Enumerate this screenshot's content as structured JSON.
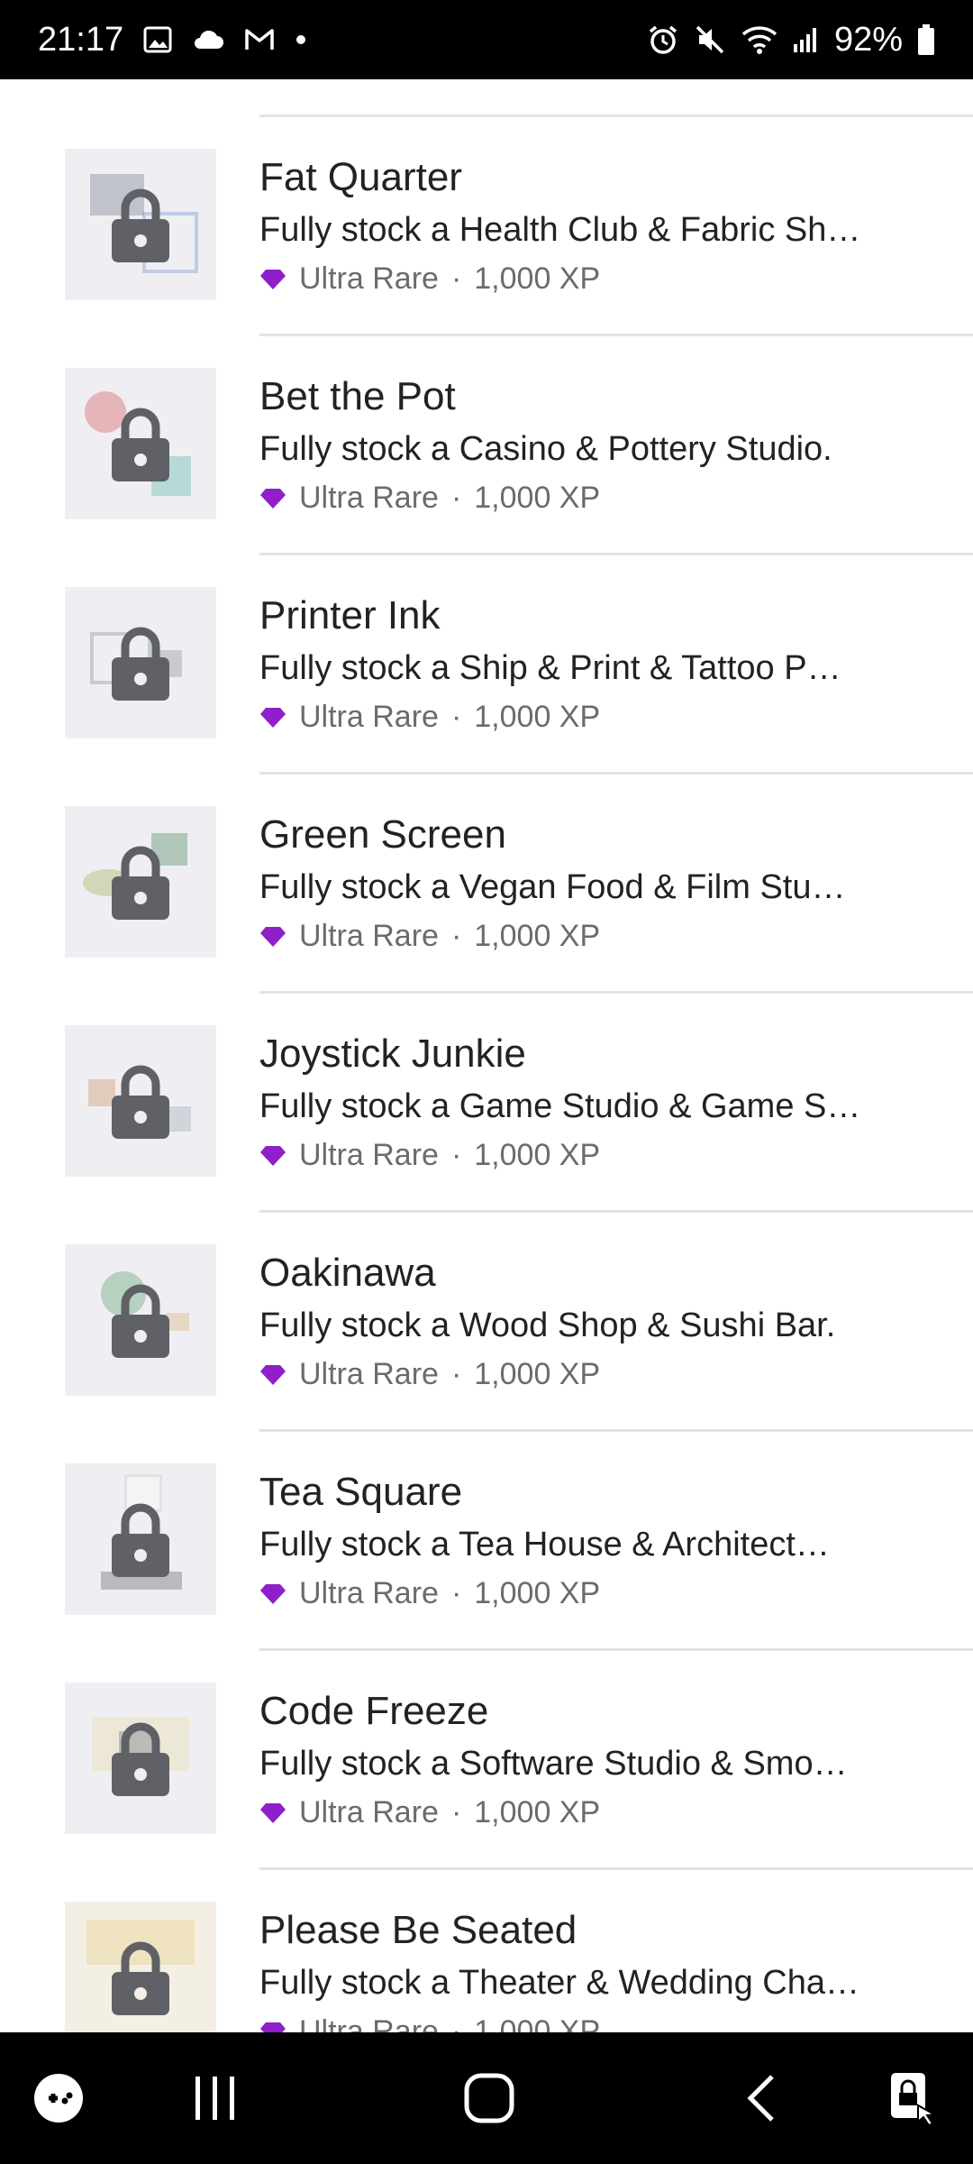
{
  "status_bar": {
    "time": "21:17",
    "battery_percent": "92%",
    "left_icons": [
      "gallery-icon",
      "cloud-icon",
      "gmail-icon",
      "dot-icon"
    ],
    "right_icons": [
      "alarm-icon",
      "mute-icon",
      "wifi-icon",
      "signal-icon",
      "battery-icon"
    ]
  },
  "achievements": [
    {
      "title": "Fat Quarter",
      "description": "Fully stock a Health Club & Fabric Sh…",
      "rarity": "Ultra Rare",
      "xp": "1,000 XP"
    },
    {
      "title": "Bet the Pot",
      "description": "Fully stock a Casino & Pottery Studio.",
      "rarity": "Ultra Rare",
      "xp": "1,000 XP"
    },
    {
      "title": "Printer Ink",
      "description": "Fully stock a Ship & Print & Tattoo P…",
      "rarity": "Ultra Rare",
      "xp": "1,000 XP"
    },
    {
      "title": "Green Screen",
      "description": "Fully stock a Vegan Food & Film Stu…",
      "rarity": "Ultra Rare",
      "xp": "1,000 XP"
    },
    {
      "title": "Joystick Junkie",
      "description": "Fully stock a Game Studio & Game S…",
      "rarity": "Ultra Rare",
      "xp": "1,000 XP"
    },
    {
      "title": "Oakinawa",
      "description": "Fully stock a Wood Shop & Sushi Bar.",
      "rarity": "Ultra Rare",
      "xp": "1,000 XP"
    },
    {
      "title": "Tea Square",
      "description": "Fully stock a Tea House & Architect…",
      "rarity": "Ultra Rare",
      "xp": "1,000 XP"
    },
    {
      "title": "Code Freeze",
      "description": "Fully stock a Software Studio & Smo…",
      "rarity": "Ultra Rare",
      "xp": "1,000 XP"
    },
    {
      "title": "Please Be Seated",
      "description": "Fully stock a Theater & Wedding Cha…",
      "rarity": "Ultra Rare",
      "xp": "1,000 XP"
    }
  ],
  "meta_separator": "·",
  "colors": {
    "gem": "#8e1fc9",
    "lock": "#5f6166",
    "thumb_bg": "#efeff3",
    "divider": "#e3e3e3"
  },
  "nav_bar": {
    "buttons": [
      "game-launcher-icon",
      "recent-apps-icon",
      "home-icon",
      "back-icon",
      "screen-lock-icon"
    ]
  }
}
